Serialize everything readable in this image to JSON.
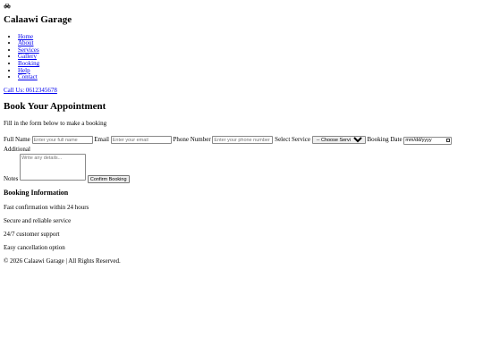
{
  "header": {
    "logo_icon": "car-icon",
    "brand": "Calaawi Garage"
  },
  "nav": {
    "items": [
      {
        "label": "Home"
      },
      {
        "label": "About"
      },
      {
        "label": "Services"
      },
      {
        "label": "Gallery"
      },
      {
        "label": "Booking"
      },
      {
        "label": "Help"
      },
      {
        "label": "Contact"
      }
    ]
  },
  "call": {
    "label": "Call Us: 0612345678"
  },
  "booking": {
    "title": "Book Your Appointment",
    "intro": "Fill in the form below to make a booking",
    "full_name_label": "Full Name",
    "full_name_placeholder": "Enter your full name",
    "email_label": "Email",
    "email_placeholder": "Enter your email",
    "phone_label": "Phone Number",
    "phone_placeholder": "Enter your phone number",
    "service_label": "Select Service",
    "service_selected": "-- Choose Service --",
    "date_label": "Booking Date",
    "date_value": "mm/dd/yyyy",
    "notes_label_1": "Additional",
    "notes_label_2": "Notes",
    "notes_placeholder": "Write any details...",
    "confirm_label": "Confirm Booking"
  },
  "info": {
    "title": "Booking Information",
    "items": [
      {
        "text": "Fast confirmation within 24 hours"
      },
      {
        "text": "Secure and reliable service"
      },
      {
        "text": "24/7 customer support"
      },
      {
        "text": "Easy cancellation option"
      }
    ]
  },
  "footer": {
    "text": "© 2026 Calaawi Garage | All Rights Reserved."
  }
}
